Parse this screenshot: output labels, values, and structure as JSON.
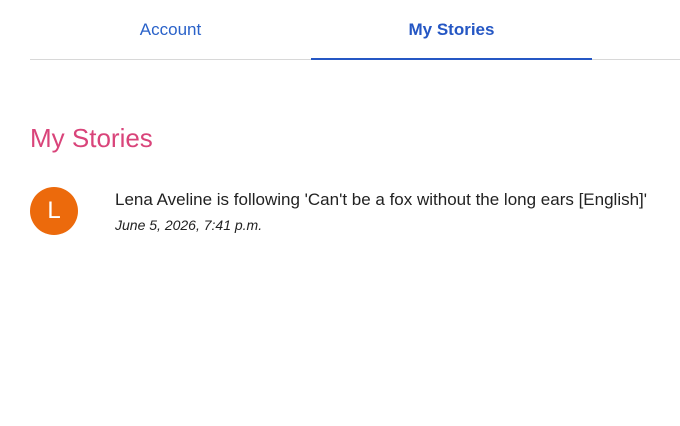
{
  "tabs": {
    "account_label": "Account",
    "stories_label": "My Stories",
    "active": "My Stories"
  },
  "section": {
    "title": "My Stories"
  },
  "stories": [
    {
      "avatar_letter": "L",
      "avatar_color": "#ec6a0c",
      "text": "Lena Aveline is following 'Can't be a fox without the long ears [English]'",
      "date": "June 5, 2026, 7:41 p.m."
    }
  ],
  "colors": {
    "tab_active": "#2557c4",
    "section_title": "#d9447a"
  }
}
